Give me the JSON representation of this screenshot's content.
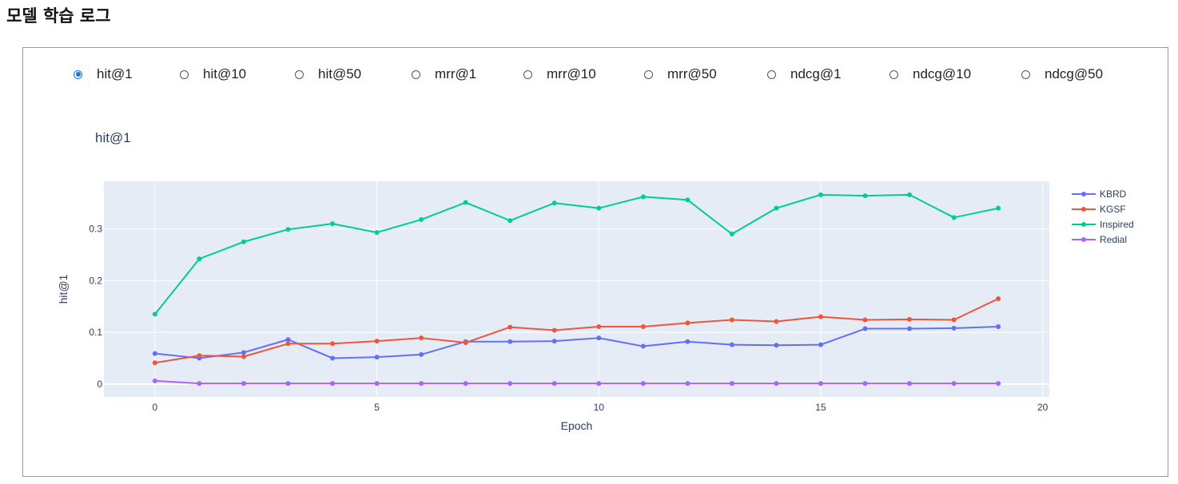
{
  "page": {
    "title": "모델 학습 로그"
  },
  "metric_selector": {
    "options": [
      {
        "label": "hit@1",
        "selected": true
      },
      {
        "label": "hit@10",
        "selected": false
      },
      {
        "label": "hit@50",
        "selected": false
      },
      {
        "label": "mrr@1",
        "selected": false
      },
      {
        "label": "mrr@10",
        "selected": false
      },
      {
        "label": "mrr@50",
        "selected": false
      },
      {
        "label": "ndcg@1",
        "selected": false
      },
      {
        "label": "ndcg@10",
        "selected": false
      },
      {
        "label": "ndcg@50",
        "selected": false
      }
    ]
  },
  "colors": {
    "accent": "#1a73e8",
    "plot_bg": "#e5ecf6",
    "grid": "#ffffff",
    "text": "#2a3f5f"
  },
  "chart_data": {
    "type": "line",
    "title": "hit@1",
    "xlabel": "Epoch",
    "ylabel": "hit@1",
    "xlim": [
      -1.15,
      20.15
    ],
    "ylim": [
      -0.025,
      0.392
    ],
    "xticks": [
      0,
      5,
      10,
      15,
      20
    ],
    "yticks": [
      0,
      0.1,
      0.2,
      0.3
    ],
    "grid": true,
    "legend_position": "right",
    "x": [
      0,
      1,
      2,
      3,
      4,
      5,
      6,
      7,
      8,
      9,
      10,
      11,
      12,
      13,
      14,
      15,
      16,
      17,
      18,
      19
    ],
    "series": [
      {
        "name": "KBRD",
        "color": "#636efa",
        "values": [
          0.059,
          0.05,
          0.061,
          0.086,
          0.05,
          0.052,
          0.057,
          0.082,
          0.082,
          0.083,
          0.089,
          0.073,
          0.082,
          0.076,
          0.075,
          0.076,
          0.107,
          0.107,
          0.108,
          0.111
        ]
      },
      {
        "name": "KGSF",
        "color": "#ef553b",
        "values": [
          0.041,
          0.055,
          0.053,
          0.078,
          0.078,
          0.083,
          0.089,
          0.08,
          0.11,
          0.104,
          0.111,
          0.111,
          0.118,
          0.124,
          0.121,
          0.13,
          0.124,
          0.125,
          0.124,
          0.165
        ]
      },
      {
        "name": "Inspired",
        "color": "#00cc96",
        "values": [
          0.135,
          0.242,
          0.275,
          0.299,
          0.31,
          0.293,
          0.318,
          0.351,
          0.316,
          0.35,
          0.34,
          0.362,
          0.356,
          0.29,
          0.34,
          0.366,
          0.364,
          0.366,
          0.322,
          0.34
        ]
      },
      {
        "name": "Redial",
        "color": "#ab63fa",
        "values": [
          0.006,
          0.001,
          0.001,
          0.001,
          0.001,
          0.001,
          0.001,
          0.001,
          0.001,
          0.001,
          0.001,
          0.001,
          0.001,
          0.001,
          0.001,
          0.001,
          0.001,
          0.001,
          0.001,
          0.001
        ]
      }
    ]
  }
}
